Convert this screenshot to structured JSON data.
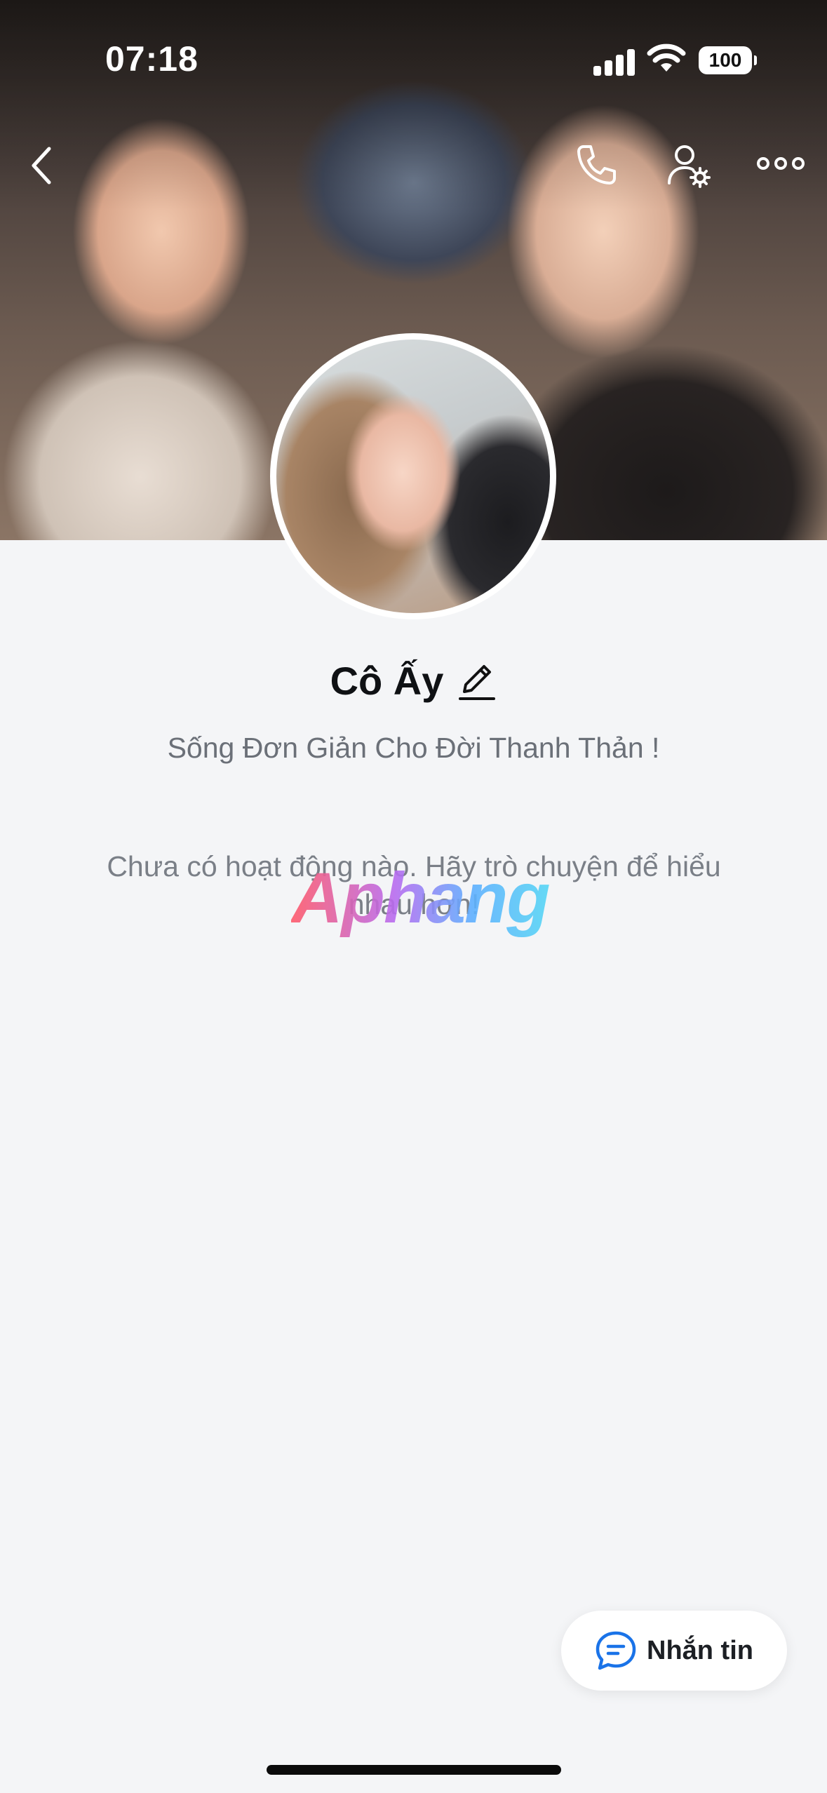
{
  "status_bar": {
    "time": "07:18",
    "battery": "100"
  },
  "topbar": {
    "back_icon": "chevron-left-icon",
    "call_icon": "phone-icon",
    "profile_settings_icon": "user-settings-icon",
    "more_icon": "more-horizontal-icon"
  },
  "profile": {
    "name": "Cô Ấy",
    "status": "Sống Đơn Giản Cho Đời Thanh Thản !"
  },
  "activity": {
    "empty_message": "Chưa có hoạt động nào. Hãy trò chuyện để hiểu nhau hơn!"
  },
  "watermark": "Aphang",
  "actions": {
    "message_label": "Nhắn tin",
    "message_icon": "chat-bubble-icon"
  },
  "colors": {
    "background": "#f4f5f7",
    "accent": "#1a73e8"
  }
}
